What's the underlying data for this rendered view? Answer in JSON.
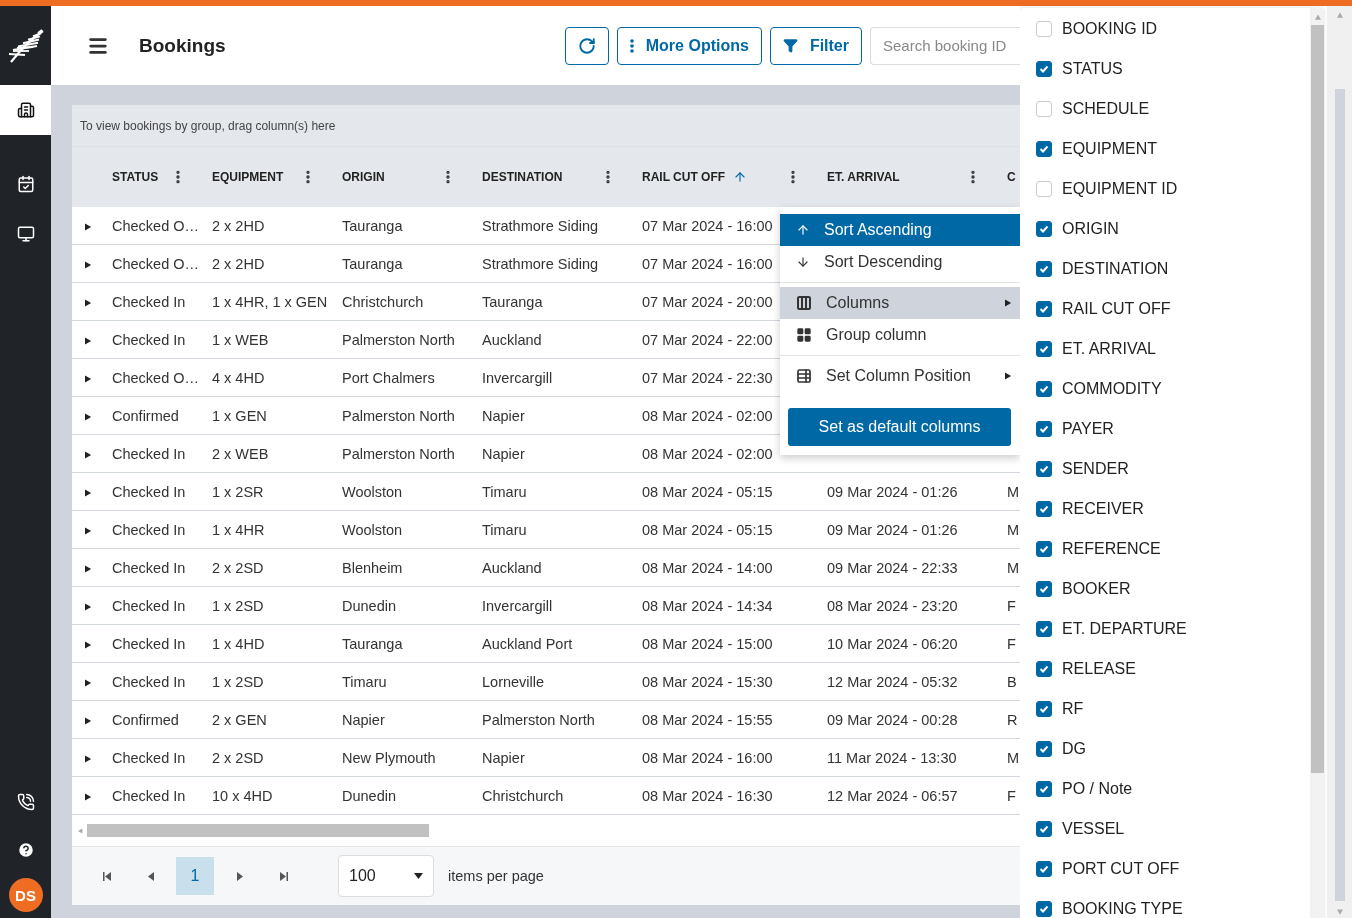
{
  "sidebar": {
    "items": [
      {
        "selected": true
      },
      {
        "selected": false
      },
      {
        "selected": false
      }
    ],
    "avatar": "DS"
  },
  "header": {
    "title": "Bookings",
    "buttons": [
      "More Options",
      "Filter"
    ],
    "search": {
      "placeholder": "Search booking ID"
    }
  },
  "table": {
    "group_hint": "To view bookings by group, drag column(s) here",
    "columns": [
      {
        "label": "STATUS",
        "sorted": false
      },
      {
        "label": "EQUIPMENT",
        "sorted": false
      },
      {
        "label": "ORIGIN",
        "sorted": false
      },
      {
        "label": "DESTINATION",
        "sorted": false
      },
      {
        "label": "RAIL CUT OFF",
        "sorted": true
      },
      {
        "label": "ET. ARRIVAL",
        "sorted": false
      },
      {
        "label": "C",
        "sorted": false
      }
    ],
    "rows": [
      {
        "cells": [
          "Checked O…",
          "2 x 2HD",
          "Tauranga",
          "Strathmore Siding",
          "07 Mar 2024 - 16:00"
        ]
      },
      {
        "cells": [
          "Checked O…",
          "2 x 2HD",
          "Tauranga",
          "Strathmore Siding",
          "07 Mar 2024 - 16:00"
        ]
      },
      {
        "cells": [
          "Checked In",
          "1 x 4HR, 1 x GEN",
          "Christchurch",
          "Tauranga",
          "07 Mar 2024 - 20:00"
        ]
      },
      {
        "cells": [
          "Checked In",
          "1 x WEB",
          "Palmerston North",
          "Auckland",
          "07 Mar 2024 - 22:00"
        ]
      },
      {
        "cells": [
          "Checked O…",
          "4 x 4HD",
          "Port Chalmers",
          "Invercargill",
          "07 Mar 2024 - 22:30"
        ]
      },
      {
        "cells": [
          "Confirmed",
          "1 x GEN",
          "Palmerston North",
          "Napier",
          "08 Mar 2024 - 02:00"
        ]
      },
      {
        "cells": [
          "Checked In",
          "2 x WEB",
          "Palmerston North",
          "Napier",
          "08 Mar 2024 - 02:00"
        ]
      },
      {
        "cells": [
          "Checked In",
          "1 x 2SR",
          "Woolston",
          "Timaru",
          "08 Mar 2024 - 05:15",
          "09 Mar 2024 - 01:26",
          "M"
        ]
      },
      {
        "cells": [
          "Checked In",
          "1 x 4HR",
          "Woolston",
          "Timaru",
          "08 Mar 2024 - 05:15",
          "09 Mar 2024 - 01:26",
          "M"
        ]
      },
      {
        "cells": [
          "Checked In",
          "2 x 2SD",
          "Blenheim",
          "Auckland",
          "08 Mar 2024 - 14:00",
          "09 Mar 2024 - 22:33",
          "M"
        ]
      },
      {
        "cells": [
          "Checked In",
          "1 x 2SD",
          "Dunedin",
          "Invercargill",
          "08 Mar 2024 - 14:34",
          "08 Mar 2024 - 23:20",
          "F"
        ]
      },
      {
        "cells": [
          "Checked In",
          "1 x 4HD",
          "Tauranga",
          "Auckland Port",
          "08 Mar 2024 - 15:00",
          "10 Mar 2024 - 06:20",
          "F"
        ]
      },
      {
        "cells": [
          "Checked In",
          "1 x 2SD",
          "Timaru",
          "Lorneville",
          "08 Mar 2024 - 15:30",
          "12 Mar 2024 - 05:32",
          "B"
        ]
      },
      {
        "cells": [
          "Confirmed",
          "2 x GEN",
          "Napier",
          "Palmerston North",
          "08 Mar 2024 - 15:55",
          "09 Mar 2024 - 00:28",
          "R"
        ]
      },
      {
        "cells": [
          "Checked In",
          "2 x 2SD",
          "New Plymouth",
          "Napier",
          "08 Mar 2024 - 16:00",
          "11 Mar 2024 - 13:30",
          "M"
        ]
      },
      {
        "cells": [
          "Checked In",
          "10 x 4HD",
          "Dunedin",
          "Christchurch",
          "08 Mar 2024 - 16:30",
          "12 Mar 2024 - 06:57",
          "F"
        ]
      }
    ]
  },
  "context_menu": {
    "items": [
      {
        "label": "Sort Ascending",
        "selected": true,
        "highlighted": false,
        "submenu": false
      },
      {
        "label": "Sort Descending",
        "selected": false,
        "highlighted": false,
        "submenu": false
      },
      {
        "label": "Columns",
        "selected": false,
        "highlighted": true,
        "submenu": true
      },
      {
        "label": "Group column",
        "selected": false,
        "highlighted": false,
        "submenu": false
      },
      {
        "label": "Set Column Position",
        "selected": false,
        "highlighted": false,
        "submenu": true
      }
    ],
    "button": "Set as default columns"
  },
  "pager": {
    "pages": [
      {
        "label": "1",
        "selected": true
      }
    ],
    "page_size": "100",
    "page_size_label": "items per page"
  },
  "column_chooser": {
    "items": [
      {
        "label": "BOOKING ID",
        "checked": false
      },
      {
        "label": "STATUS",
        "checked": true
      },
      {
        "label": "SCHEDULE",
        "checked": false
      },
      {
        "label": "EQUIPMENT",
        "checked": true
      },
      {
        "label": "EQUIPMENT ID",
        "checked": false
      },
      {
        "label": "ORIGIN",
        "checked": true
      },
      {
        "label": "DESTINATION",
        "checked": true
      },
      {
        "label": "RAIL CUT OFF",
        "checked": true
      },
      {
        "label": "ET. ARRIVAL",
        "checked": true
      },
      {
        "label": "COMMODITY",
        "checked": true
      },
      {
        "label": "PAYER",
        "checked": true
      },
      {
        "label": "SENDER",
        "checked": true
      },
      {
        "label": "RECEIVER",
        "checked": true
      },
      {
        "label": "REFERENCE",
        "checked": true
      },
      {
        "label": "BOOKER",
        "checked": true
      },
      {
        "label": "ET. DEPARTURE",
        "checked": true
      },
      {
        "label": "RELEASE",
        "checked": true
      },
      {
        "label": "RF",
        "checked": true
      },
      {
        "label": "DG",
        "checked": true
      },
      {
        "label": "PO / Note",
        "checked": true
      },
      {
        "label": "VESSEL",
        "checked": true
      },
      {
        "label": "PORT CUT OFF",
        "checked": true
      },
      {
        "label": "BOOKING TYPE",
        "checked": true
      }
    ]
  }
}
